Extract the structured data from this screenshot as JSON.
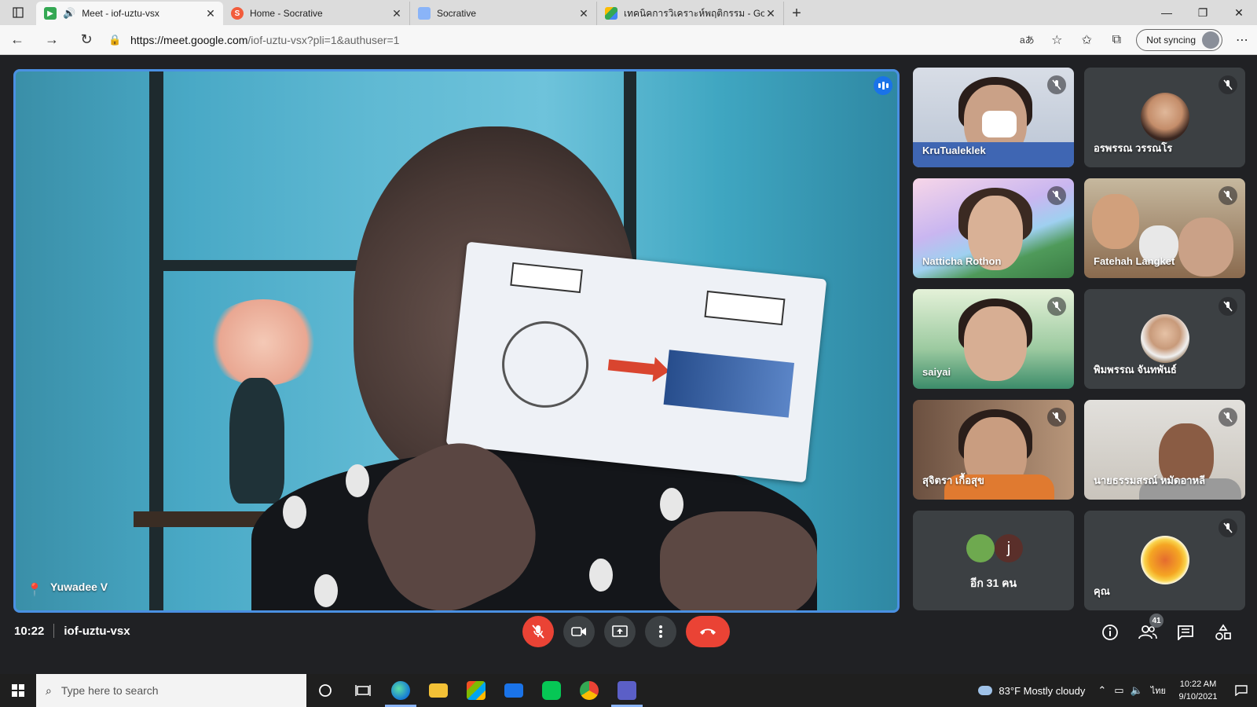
{
  "browser": {
    "tabs": [
      {
        "title": "Meet - iof-uztu-vsx",
        "active": true,
        "favicon_color": "#34a853"
      },
      {
        "title": "Home - Socrative",
        "active": false,
        "favicon_color": "#f25c3b"
      },
      {
        "title": "Socrative",
        "active": false,
        "favicon_color": "#8ab4f8"
      },
      {
        "title": "เทคนิคการวิเคราะห์พฤติกรรม - Goog",
        "active": false,
        "favicon_color": "#fbbc04"
      }
    ],
    "url_host": "https://meet.google.com",
    "url_path": "/iof-uztu-vsx?pli=1&authuser=1",
    "sync_label": "Not syncing"
  },
  "meet": {
    "main_speaker": "Yuwadee V",
    "participants": [
      {
        "name": "KruTualeklek"
      },
      {
        "name": "อรพรรณ วรรณโร"
      },
      {
        "name": "Natticha Rothon"
      },
      {
        "name": "Fatehah Langket"
      },
      {
        "name": "saiyai"
      },
      {
        "name": "พิมพรรณ จันทพันธ์"
      },
      {
        "name": "สุจิตรา เกื้อสุข"
      },
      {
        "name": "นายธรรมสรณ์ หมัดอาหลี"
      },
      {
        "name": "คุณ"
      }
    ],
    "more_people_label": "อีก 31 คน",
    "more_avatar_letter": "j",
    "time": "10:22",
    "meeting_code": "iof-uztu-vsx",
    "people_count": "41"
  },
  "taskbar": {
    "search_placeholder": "Type here to search",
    "weather": "83°F  Mostly cloudy",
    "lang": "ไทย",
    "clock_time": "10:22 AM",
    "clock_date": "9/10/2021"
  },
  "colors": {
    "accent_blue": "#1a73e8",
    "end_call_red": "#ea4335",
    "meet_bg": "#202124"
  }
}
